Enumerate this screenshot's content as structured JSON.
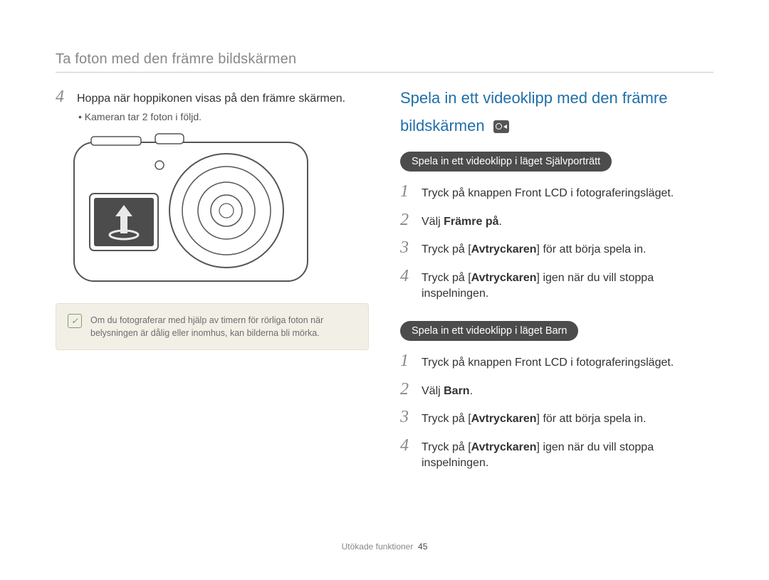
{
  "header": "Ta foton med den främre bildskärmen",
  "left": {
    "step4_num": "4",
    "step4_text": "Hoppa när hoppikonen visas på den främre skärmen.",
    "sub_bullet": "Kameran tar 2 foton i följd.",
    "note_icon_glyph": "✓",
    "note_text": "Om du fotograferar med hjälp av timern för rörliga foton när belysningen är dålig eller inomhus, kan bilderna bli mörka."
  },
  "right": {
    "section_title_l1": "Spela in ett videoklipp med den främre",
    "section_title_l2": "bildskärmen",
    "pill_self": "Spela in ett videoklipp i läget Självporträtt",
    "self_steps": {
      "s1_num": "1",
      "s1_text": "Tryck på knappen Front LCD i fotograferingsläget.",
      "s2_num": "2",
      "s2_pre": "Välj ",
      "s2_bold": "Främre på",
      "s2_post": ".",
      "s3_num": "3",
      "s3_pre": "Tryck på [",
      "s3_bold": "Avtryckaren",
      "s3_post": "] för att börja spela in.",
      "s4_num": "4",
      "s4_pre": "Tryck på [",
      "s4_bold": "Avtryckaren",
      "s4_post": "] igen när du vill stoppa inspelningen."
    },
    "pill_child": "Spela in ett videoklipp i läget Barn",
    "child_steps": {
      "s1_num": "1",
      "s1_text": "Tryck på knappen Front LCD i fotograferingsläget.",
      "s2_num": "2",
      "s2_pre": "Välj ",
      "s2_bold": "Barn",
      "s2_post": ".",
      "s3_num": "3",
      "s3_pre": "Tryck på [",
      "s3_bold": "Avtryckaren",
      "s3_post": "] för att börja spela in.",
      "s4_num": "4",
      "s4_pre": "Tryck på [",
      "s4_bold": "Avtryckaren",
      "s4_post": "] igen när du vill stoppa inspelningen."
    }
  },
  "footer": {
    "section": "Utökade funktioner",
    "page": "45"
  }
}
